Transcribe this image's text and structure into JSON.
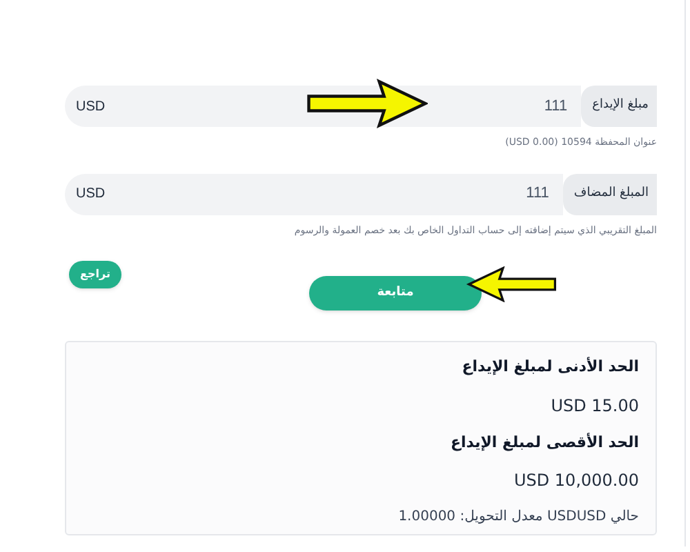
{
  "fields": [
    {
      "label": "مبلغ الإيداع",
      "value": "111",
      "currency": "USD",
      "hint": "عنوان المحفظة 10594 (USD 0.00)"
    },
    {
      "label": "المبلغ المضاف",
      "value": "111",
      "currency": "USD",
      "hint": "المبلغ التقريبي الذي سيتم إضافته إلى حساب التداول الخاص بك بعد خصم العمولة والرسوم"
    }
  ],
  "back_button": "تراجع",
  "continue_button": "متابعة",
  "limits": [
    {
      "kind": "heading",
      "text": "الحد الأدنى لمبلغ الإيداع"
    },
    {
      "kind": "value",
      "text": "USD 15.00"
    },
    {
      "kind": "heading",
      "text": "الحد الأقصى لمبلغ الإيداع"
    },
    {
      "kind": "value",
      "text": "USD 10,000.00"
    },
    {
      "kind": "note",
      "text": "حالي USDUSD معدل التحويل: 1.00000"
    }
  ]
}
